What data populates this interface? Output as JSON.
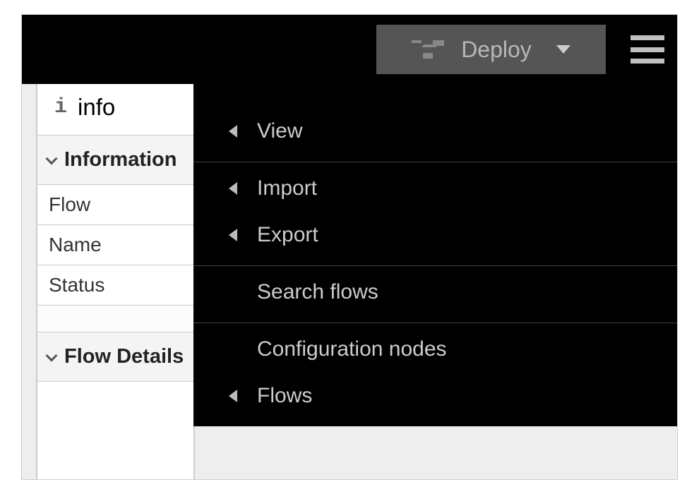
{
  "header": {
    "deploy_label": "Deploy"
  },
  "info_panel": {
    "tab_label": "info",
    "sections": [
      {
        "title": "Information",
        "rows": [
          "Flow",
          "Name",
          "Status"
        ]
      },
      {
        "title": "Flow Details",
        "rows": []
      }
    ]
  },
  "menu": {
    "groups": [
      {
        "items": [
          {
            "label": "View",
            "has_submenu": true
          }
        ]
      },
      {
        "items": [
          {
            "label": "Import",
            "has_submenu": true
          },
          {
            "label": "Export",
            "has_submenu": true
          }
        ]
      },
      {
        "items": [
          {
            "label": "Search flows",
            "has_submenu": false
          }
        ]
      },
      {
        "items": [
          {
            "label": "Configuration nodes",
            "has_submenu": false
          },
          {
            "label": "Flows",
            "has_submenu": true
          }
        ]
      }
    ]
  }
}
